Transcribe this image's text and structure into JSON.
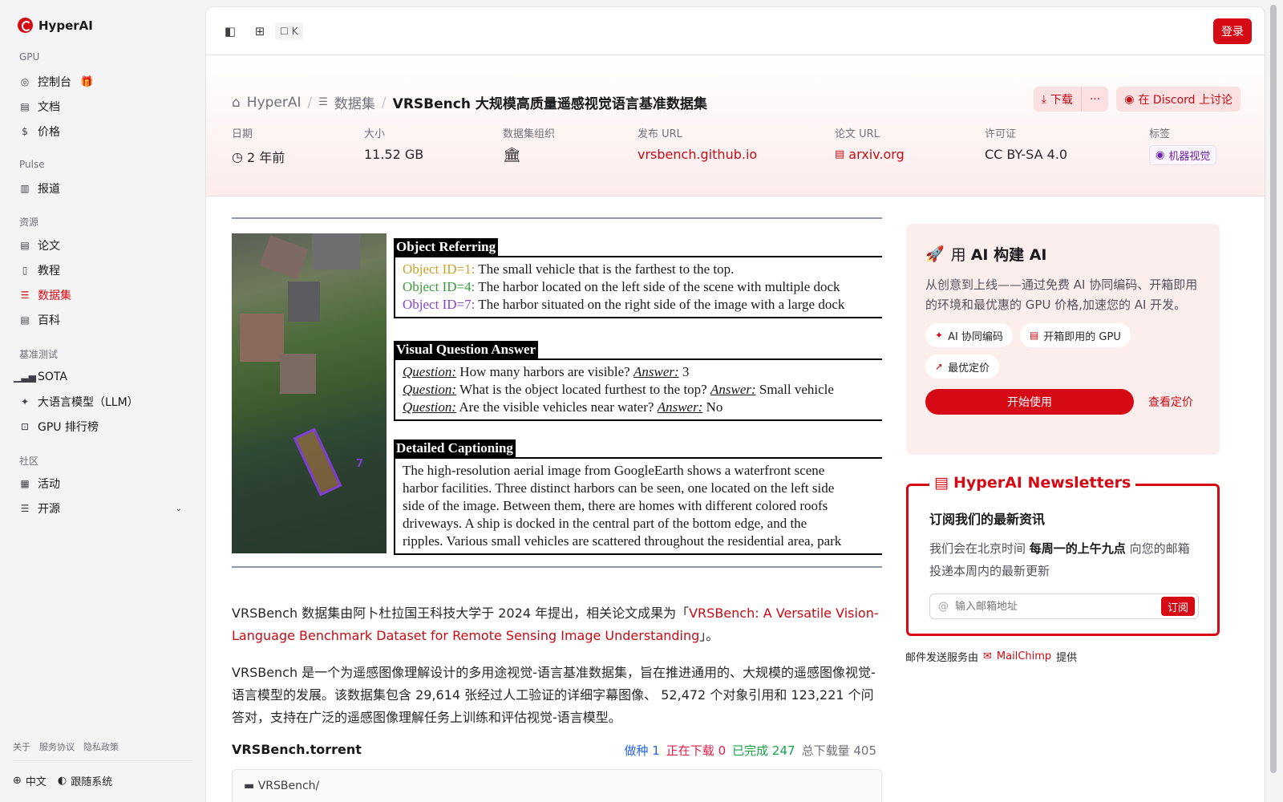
{
  "brand": {
    "name": "HyperAI"
  },
  "sidebar": {
    "sections": {
      "gpu": "GPU",
      "pulse": "Pulse",
      "resources": "资源",
      "benchmark": "基准测试",
      "community": "社区"
    },
    "items": {
      "console": "控制台",
      "docs": "文档",
      "pricing": "价格",
      "reports": "报道",
      "papers": "论文",
      "tutorials": "教程",
      "datasets": "数据集",
      "wiki": "百科",
      "sota": "SOTA",
      "llm": "大语言模型（LLM）",
      "gpu_rank": "GPU 排行榜",
      "events": "活动",
      "opensource": "开源"
    },
    "footer_links": [
      "关于",
      "服务协议",
      "隐私政策"
    ],
    "language": "中文",
    "theme": "跟随系统"
  },
  "topbar": {
    "shortcut_key": "K",
    "login_label": "登录"
  },
  "breadcrumb": {
    "home": "HyperAI",
    "section": "数据集",
    "current": "VRSBench 大规模高质量遥感视觉语言基准数据集"
  },
  "actions": {
    "download": "下载",
    "more": "···",
    "discord": "在 Discord 上讨论"
  },
  "meta": {
    "date_label": "日期",
    "date_value": "2 年前",
    "size_label": "大小",
    "size_value": "11.52 GB",
    "org_label": "数据集组织",
    "release_label": "发布 URL",
    "release_value": "vrsbench.github.io",
    "paper_label": "论文 URL",
    "paper_value": "arxiv.org",
    "license_label": "许可证",
    "license_value": "CC BY-SA 4.0",
    "tags_label": "标签",
    "tag": "机器视觉"
  },
  "figure": {
    "sec1_title": "Object Referring",
    "sec1_lines": [
      {
        "id": "Object ID=1:",
        "text": " The small vehicle that is the farthest to the top."
      },
      {
        "id": "Object ID=4:",
        "text": " The harbor located on the left side of the scene with multiple dock"
      },
      {
        "id": "Object ID=7:",
        "text": " The harbor situated on the right side of the image with a large dock"
      }
    ],
    "sec2_title": "Visual Question Answer",
    "qa": [
      {
        "q": "Question:",
        "qt": " How many harbors are visible? ",
        "a": "Answer:",
        "at": " 3"
      },
      {
        "q": "Question:",
        "qt": " What is the object located furthest to the top? ",
        "a": "Answer:",
        "at": " Small vehicle"
      },
      {
        "q": "Question:",
        "qt": " Are the visible vehicles near water? ",
        "a": "Answer:",
        "at": " No"
      }
    ],
    "sec3_title": "Detailed Captioning",
    "caption_lines": [
      "The high-resolution aerial image from GoogleEarth shows a waterfront scene",
      "harbor facilities. Three distinct harbors can be seen, one located on the left side",
      "side of the image. Between them, there are homes with different colored roofs",
      "driveways. A ship is docked in the central part of the bottom edge, and the",
      "ripples. Various small vehicles are scattered throughout the residential area, park"
    ],
    "box_label": "7"
  },
  "description": {
    "p1_prefix": "VRSBench 数据集由阿卜杜拉国王科技大学于 2024 年提出，相关论文成果为「",
    "p1_link": "VRSBench: A Versatile Vision-Language Benchmark Dataset for Remote Sensing Image Understanding",
    "p1_suffix": "」。",
    "p2": "VRSBench 是一个为遥感图像理解设计的多用途视觉-语言基准数据集，旨在推进通用的、大规模的遥感图像视觉-语言模型的发展。该数据集包含 29,614 张经过人工验证的详细字幕图像、 52,472 个对象引用和 123,221 个问答对，支持在广泛的遥感图像理解任务上训练和评估视觉-语言模型。"
  },
  "torrent": {
    "title": "VRSBench.torrent",
    "seed_label": "做种",
    "seed_value": "1",
    "downloading_label": "正在下载",
    "downloading_value": "0",
    "completed_label": "已完成",
    "completed_value": "247",
    "total_label": "总下载量",
    "total_value": "405",
    "folder": "VRSBench/"
  },
  "ai_card": {
    "title_prefix": "用 ",
    "title_bold": "AI 构建 AI",
    "desc": "从创意到上线——通过免费 AI 协同编码、开箱即用的环境和最优惠的 GPU 价格,加速您的 AI 开发。",
    "chips": [
      "AI 协同编码",
      "开箱即用的 GPU",
      "最优定价"
    ],
    "start": "开始使用",
    "view_pricing": "查看定价"
  },
  "newsletter": {
    "title": "HyperAI Newsletters",
    "heading": "订阅我们的最新资讯",
    "desc_prefix": "我们会在北京时间 ",
    "desc_bold": "每周一的上午九点",
    "desc_suffix": " 向您的邮箱投递本周内的最新更新",
    "placeholder": "输入邮箱地址",
    "subscribe": "订阅",
    "footer_prefix": "邮件发送服务由",
    "footer_brand": "MailChimp",
    "footer_suffix": "提供"
  },
  "colors": {
    "accent": "#d60a14",
    "accent_soft": "#fdeeee"
  }
}
